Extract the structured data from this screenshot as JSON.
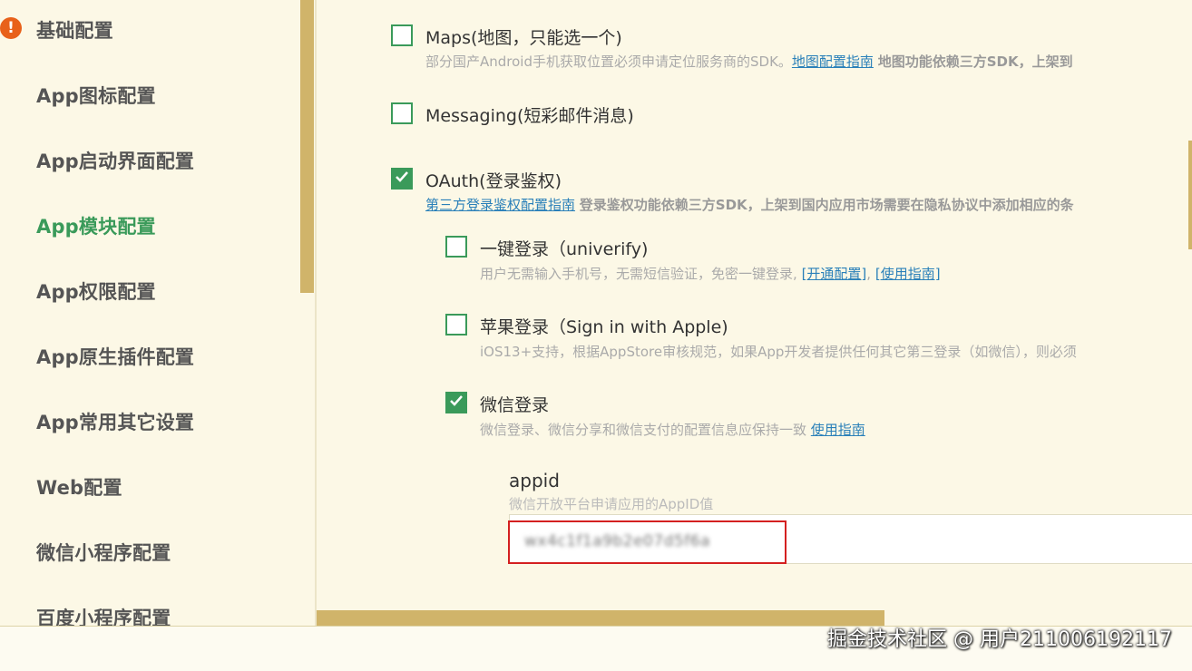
{
  "sidebar": {
    "items": [
      {
        "label": "基础配置",
        "warning": true
      },
      {
        "label": "App图标配置"
      },
      {
        "label": "App启动界面配置"
      },
      {
        "label": "App模块配置",
        "active": true
      },
      {
        "label": "App权限配置"
      },
      {
        "label": "App原生插件配置"
      },
      {
        "label": "App常用其它设置"
      },
      {
        "label": "Web配置"
      },
      {
        "label": "微信小程序配置"
      },
      {
        "label": "百度小程序配置"
      }
    ],
    "warning_icon": "exclamation-circle-icon",
    "warning_glyph": "!"
  },
  "modules": {
    "maps": {
      "label": "Maps(地图，只能选一个)",
      "checked": false,
      "desc_prefix": "部分国产Android手机获取位置必须申请定位服务商的SDK。",
      "desc_link": "地图配置指南",
      "desc_bold": "地图功能依赖三方SDK，上架到"
    },
    "messaging": {
      "label": "Messaging(短彩邮件消息)",
      "checked": false
    },
    "oauth": {
      "label": "OAuth(登录鉴权)",
      "checked": true,
      "desc_link": "第三方登录鉴权配置指南",
      "desc_bold": "登录鉴权功能依赖三方SDK，上架到国内应用市场需要在隐私协议中添加相应的条"
    },
    "univerify": {
      "label": "一键登录（univerify)",
      "checked": false,
      "desc": "用户无需输入手机号，无需短信验证，免密一键登录,",
      "link1": "[开通配置]",
      "sep": ",",
      "link2": "[使用指南]"
    },
    "apple": {
      "label": "苹果登录（Sign in with Apple)",
      "checked": false,
      "desc": "iOS13+支持，根据AppStore审核规范，如果App开发者提供任何其它第三登录（如微信），则必须"
    },
    "weixin": {
      "label": "微信登录",
      "checked": true,
      "desc": "微信登录、微信分享和微信支付的配置信息应保持一致",
      "link": "使用指南"
    },
    "appid": {
      "label": "appid",
      "hint": "微信开放平台申请应用的AppID值",
      "value": "wx4c1f1a9b2e07d5f6a"
    }
  },
  "footer": {
    "watermark": "掘金技术社区 @ 用户211006192117"
  },
  "colors": {
    "accent": "#3a9a5a",
    "link": "#2a80b9",
    "scrollbar": "#d0b46a",
    "background": "#fcf8e6",
    "highlight": "#d42020",
    "warning": "#e8611a"
  }
}
